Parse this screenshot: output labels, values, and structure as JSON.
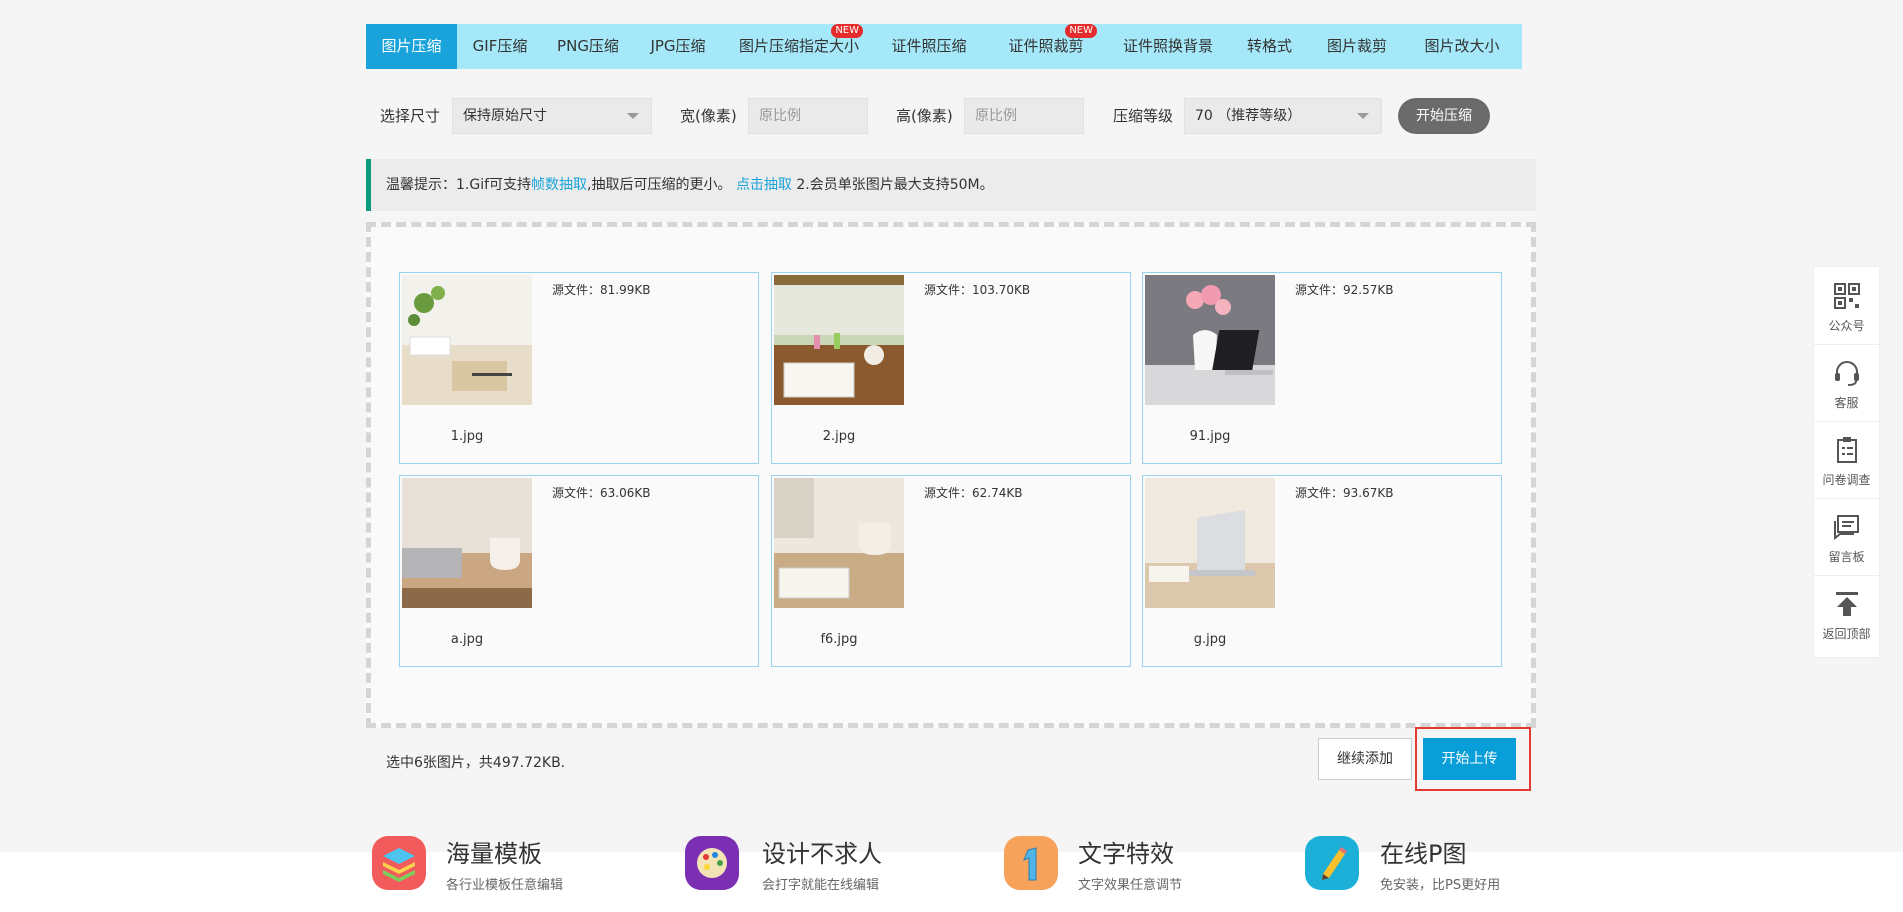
{
  "tabs": [
    {
      "label": "图片压缩",
      "active": true,
      "new": false
    },
    {
      "label": "GIF压缩",
      "active": false,
      "new": false
    },
    {
      "label": "PNG压缩",
      "active": false,
      "new": false
    },
    {
      "label": "JPG压缩",
      "active": false,
      "new": false
    },
    {
      "label": "图片压缩指定大小",
      "active": false,
      "new": true
    },
    {
      "label": "证件照压缩",
      "active": false,
      "new": false
    },
    {
      "label": "证件照裁剪",
      "active": false,
      "new": true
    },
    {
      "label": "证件照换背景",
      "active": false,
      "new": false
    },
    {
      "label": "转格式",
      "active": false,
      "new": false
    },
    {
      "label": "图片裁剪",
      "active": false,
      "new": false
    },
    {
      "label": "图片改大小",
      "active": false,
      "new": false
    }
  ],
  "new_badge": "NEW",
  "options": {
    "size_label": "选择尺寸",
    "size_value": "保持原始尺寸",
    "width_label": "宽(像素)",
    "width_placeholder": "原比例",
    "height_label": "高(像素)",
    "height_placeholder": "原比例",
    "level_label": "压缩等级",
    "level_value": "70 （推荐等级）",
    "compress_button": "开始压缩"
  },
  "notice": {
    "prefix": "温馨提示：1.Gif可支持",
    "link1": "帧数抽取",
    "middle": ",抽取后可压缩的更小。 ",
    "link2": "点击抽取",
    "suffix": " 2.会员单张图片最大支持50M。"
  },
  "files": [
    {
      "name": "1.jpg",
      "size": "源文件：81.99KB"
    },
    {
      "name": "2.jpg",
      "size": "源文件：103.70KB"
    },
    {
      "name": "91.jpg",
      "size": "源文件：92.57KB"
    },
    {
      "name": "a.jpg",
      "size": "源文件：63.06KB"
    },
    {
      "name": "f6.jpg",
      "size": "源文件：62.74KB"
    },
    {
      "name": "g.jpg",
      "size": "源文件：93.67KB"
    }
  ],
  "summary": "选中6张图片，共497.72KB.",
  "continue_button": "继续添加",
  "upload_button": "开始上传",
  "features": [
    {
      "title": "海量模板",
      "subtitle": "各行业模板任意编辑",
      "icon": "layers-icon",
      "color": "#f25b5b"
    },
    {
      "title": "设计不求人",
      "subtitle": "会打字就能在线编辑",
      "icon": "palette-icon",
      "color": "#7b2fb3"
    },
    {
      "title": "文字特效",
      "subtitle": "文字效果任意调节",
      "icon": "number-one-icon",
      "color": "#f6a25a"
    },
    {
      "title": "在线P图",
      "subtitle": "免安装，比PS更好用",
      "icon": "pencil-icon",
      "color": "#1cb0d8"
    }
  ],
  "sidebar": [
    {
      "label": "公众号",
      "icon": "qrcode-icon"
    },
    {
      "label": "客服",
      "icon": "headset-icon"
    },
    {
      "label": "问卷调查",
      "icon": "clipboard-icon"
    },
    {
      "label": "留言板",
      "icon": "message-board-icon"
    },
    {
      "label": "返回顶部",
      "icon": "back-to-top-icon"
    }
  ],
  "colors": {
    "accent": "#1aa3da",
    "tabbar": "#a5e8f9",
    "upload": "#0a9ed8",
    "highlight": "#e53935",
    "notice_bar": "#0a9b7d"
  }
}
